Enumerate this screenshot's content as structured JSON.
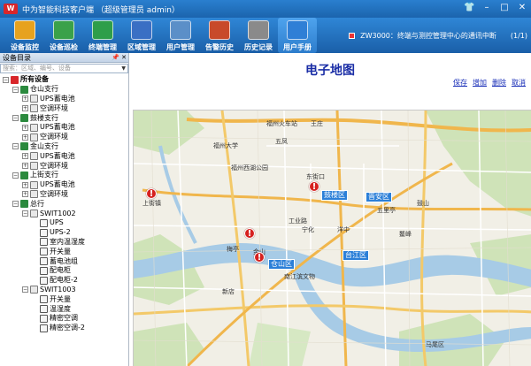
{
  "window": {
    "title": "中为智能科技客户端 （超级管理员 admin）",
    "logo_text": "W"
  },
  "toolbar": {
    "items": [
      {
        "label": "设备监控",
        "icon": "monitor-eye-icon",
        "color": "#e7a21e"
      },
      {
        "label": "设备巡检",
        "icon": "device-check-icon",
        "color": "#3aa14a"
      },
      {
        "label": "终端管理",
        "icon": "terminal-plus-icon",
        "color": "#2e9e4a"
      },
      {
        "label": "区域管理",
        "icon": "region-building-icon",
        "color": "#3a6fc4"
      },
      {
        "label": "用户管理",
        "icon": "users-icon",
        "color": "#5b8fc8"
      },
      {
        "label": "告警历史",
        "icon": "alarm-db-icon",
        "color": "#c84a2a"
      },
      {
        "label": "历史记录",
        "icon": "history-db-icon",
        "color": "#8a8a8a"
      },
      {
        "label": "用户手册",
        "icon": "help-icon",
        "color": "#2f7fd6"
      }
    ],
    "active_index": 7
  },
  "status": {
    "message": "ZW3000：终端与测控管理中心的通讯中断",
    "page": "(1/1)"
  },
  "sidebar": {
    "title": "设备目录",
    "search_placeholder": "搜索：区域、编号、设备",
    "tree": [
      {
        "label": "所有设备",
        "level": 0,
        "type": "root",
        "exp": "-"
      },
      {
        "label": "仓山支行",
        "level": 1,
        "type": "branch",
        "exp": "-"
      },
      {
        "label": "UPS蓄电池",
        "level": 2,
        "type": "dev",
        "exp": "+"
      },
      {
        "label": "空调环境",
        "level": 2,
        "type": "dev",
        "exp": "+"
      },
      {
        "label": "鼓楼支行",
        "level": 1,
        "type": "branch",
        "exp": "-"
      },
      {
        "label": "UPS蓄电池",
        "level": 2,
        "type": "dev",
        "exp": "+"
      },
      {
        "label": "空调环境",
        "level": 2,
        "type": "dev",
        "exp": "+"
      },
      {
        "label": "金山支行",
        "level": 1,
        "type": "branch",
        "exp": "-"
      },
      {
        "label": "UPS蓄电池",
        "level": 2,
        "type": "dev",
        "exp": "+"
      },
      {
        "label": "空调环境",
        "level": 2,
        "type": "dev",
        "exp": "+"
      },
      {
        "label": "上街支行",
        "level": 1,
        "type": "branch",
        "exp": "-"
      },
      {
        "label": "UPS蓄电池",
        "level": 2,
        "type": "dev",
        "exp": "+"
      },
      {
        "label": "空调环境",
        "level": 2,
        "type": "dev",
        "exp": "+"
      },
      {
        "label": "总行",
        "level": 1,
        "type": "branch",
        "exp": "-"
      },
      {
        "label": "SWIT1002",
        "level": 2,
        "type": "dev",
        "exp": "-"
      },
      {
        "label": "UPS",
        "level": 3,
        "type": "sub",
        "exp": ""
      },
      {
        "label": "UPS-2",
        "level": 3,
        "type": "sub",
        "exp": ""
      },
      {
        "label": "室内温湿度",
        "level": 3,
        "type": "sub",
        "exp": ""
      },
      {
        "label": "开关量",
        "level": 3,
        "type": "sub",
        "exp": ""
      },
      {
        "label": "蓄电池组",
        "level": 3,
        "type": "sub",
        "exp": ""
      },
      {
        "label": "配电柜",
        "level": 3,
        "type": "sub",
        "exp": ""
      },
      {
        "label": "配电柜-2",
        "level": 3,
        "type": "sub",
        "exp": ""
      },
      {
        "label": "SWIT1003",
        "level": 2,
        "type": "dev",
        "exp": "-"
      },
      {
        "label": "开关量",
        "level": 3,
        "type": "sub",
        "exp": ""
      },
      {
        "label": "温湿度",
        "level": 3,
        "type": "sub",
        "exp": ""
      },
      {
        "label": "精密空调",
        "level": 3,
        "type": "sub",
        "exp": ""
      },
      {
        "label": "精密空调-2",
        "level": 3,
        "type": "sub",
        "exp": ""
      }
    ]
  },
  "main": {
    "title": "电子地图",
    "actions": [
      "保存",
      "增加",
      "删除",
      "取消"
    ]
  },
  "map": {
    "district_labels": [
      "鼓楼区",
      "晋安区",
      "仓山区",
      "台江区"
    ],
    "place_labels": [
      "上街镇",
      "金山",
      "福州大学",
      "五凤",
      "东街口",
      "五里亭",
      "宁化",
      "洋中",
      "工业路",
      "梅亭",
      "鳌峰",
      "福州火车站",
      "王庄",
      "南江滨文物",
      "新店",
      "鼓山",
      "福州西湖公园",
      "马尾区"
    ],
    "alarm_count": 4
  }
}
